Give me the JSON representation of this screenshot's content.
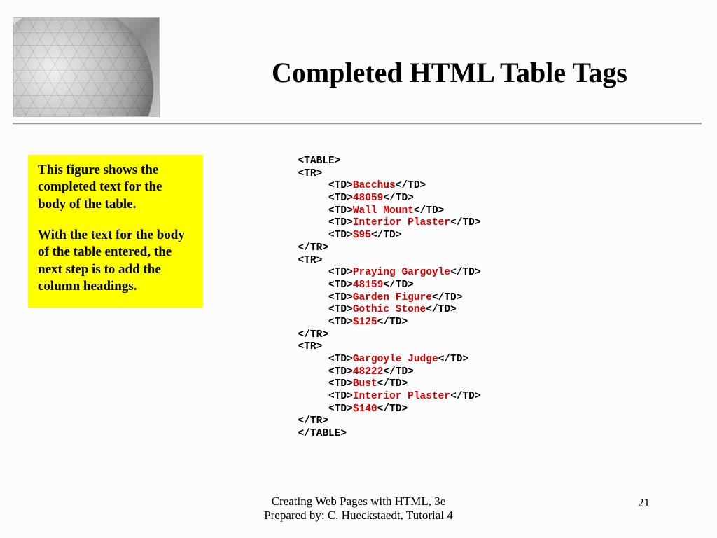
{
  "title": "Completed HTML Table Tags",
  "callout": {
    "p1": "This figure shows the completed text for the body of the table.",
    "p2": "With the text for the body of the table entered, the next step is to add the column headings."
  },
  "code": {
    "table_open": "<TABLE>",
    "tr_open": "<TR>",
    "td_open": "<TD>",
    "td_close": "</TD>",
    "tr_close": "</TR>",
    "table_close": "</TABLE>",
    "rows": [
      [
        "Bacchus",
        "48059",
        "Wall Mount",
        "Interior Plaster",
        "$95"
      ],
      [
        "Praying Gargoyle",
        "48159",
        "Garden Figure",
        "Gothic Stone",
        "$125"
      ],
      [
        "Gargoyle Judge",
        "48222",
        "Bust",
        "Interior Plaster",
        "$140"
      ]
    ]
  },
  "footer": {
    "line1": "Creating Web Pages with HTML, 3e",
    "line2": "Prepared by: C. Hueckstaedt, Tutorial 4"
  },
  "page_number": "21"
}
